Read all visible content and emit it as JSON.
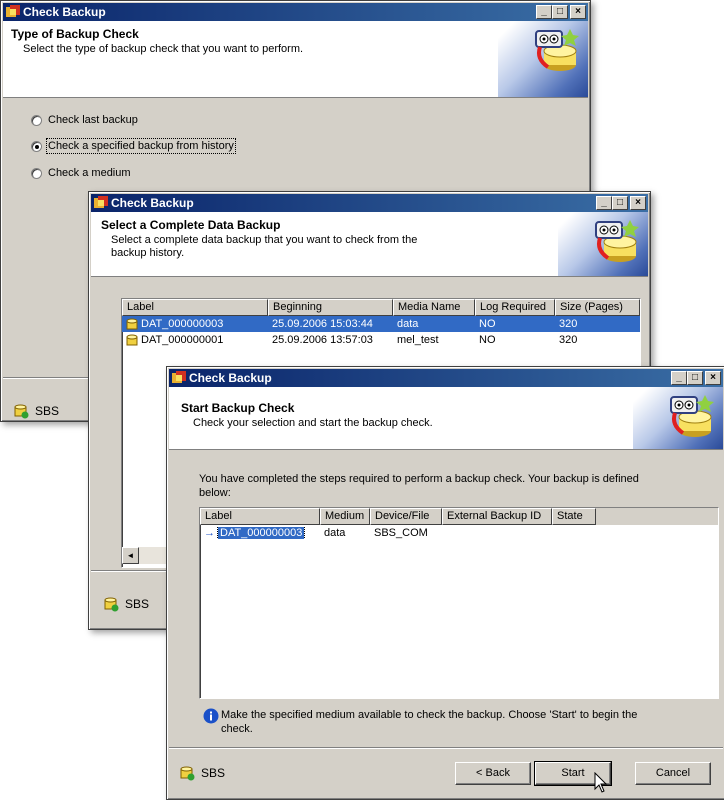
{
  "colors": {
    "title_bar_start": "#0a246a",
    "title_bar_end": "#3a6ea5",
    "dialog_face": "#d4d0c8",
    "selection": "#316ac5",
    "info": "#1a50c8"
  },
  "window1": {
    "title": "Check Backup",
    "header_title": "Type of Backup Check",
    "header_subtitle": "Select the type of backup check that you want to perform.",
    "options": [
      {
        "label": "Check last backup",
        "selected": false
      },
      {
        "label": "Check a specified backup from history",
        "selected": true
      },
      {
        "label": "Check a medium",
        "selected": false
      }
    ],
    "footer_label": "SBS"
  },
  "window2": {
    "title": "Check Backup",
    "header_title": "Select a Complete Data Backup",
    "header_subtitle_line1": "Select a complete data backup that you want to check from the",
    "header_subtitle_line2": "backup history.",
    "columns": [
      "Label",
      "Beginning",
      "Media Name",
      "Log Required",
      "Size (Pages)"
    ],
    "rows": [
      {
        "label": "DAT_000000003",
        "beginning": "25.09.2006 15:03:44",
        "media": "data",
        "log": "NO",
        "size": "320",
        "selected": true
      },
      {
        "label": "DAT_000000001",
        "beginning": "25.09.2006 13:57:03",
        "media": "mel_test",
        "log": "NO",
        "size": "320",
        "selected": false
      }
    ],
    "scroll_left_glyph": "◄",
    "footer_label": "SBS"
  },
  "window3": {
    "title": "Check Backup",
    "header_title": "Start Backup Check",
    "header_subtitle": "Check your selection and start the backup check.",
    "intro_line1": "You have completed the steps required to perform a backup check. Your backup is defined",
    "intro_line2": "below:",
    "columns": [
      "Label",
      "Medium",
      "Device/File",
      "External Backup ID",
      "State"
    ],
    "rows": [
      {
        "label": "DAT_000000003",
        "medium": "data",
        "device": "SBS_COM",
        "external_id": "",
        "state": ""
      }
    ],
    "info_line1": "Make the specified medium available to check the backup. Choose 'Start' to begin the",
    "info_line2": "check.",
    "footer_label": "SBS",
    "buttons": {
      "back": "< Back",
      "start": "Start",
      "cancel": "Cancel"
    }
  },
  "window_controls": {
    "minimize": "_",
    "maximize": "□",
    "close": "×"
  }
}
